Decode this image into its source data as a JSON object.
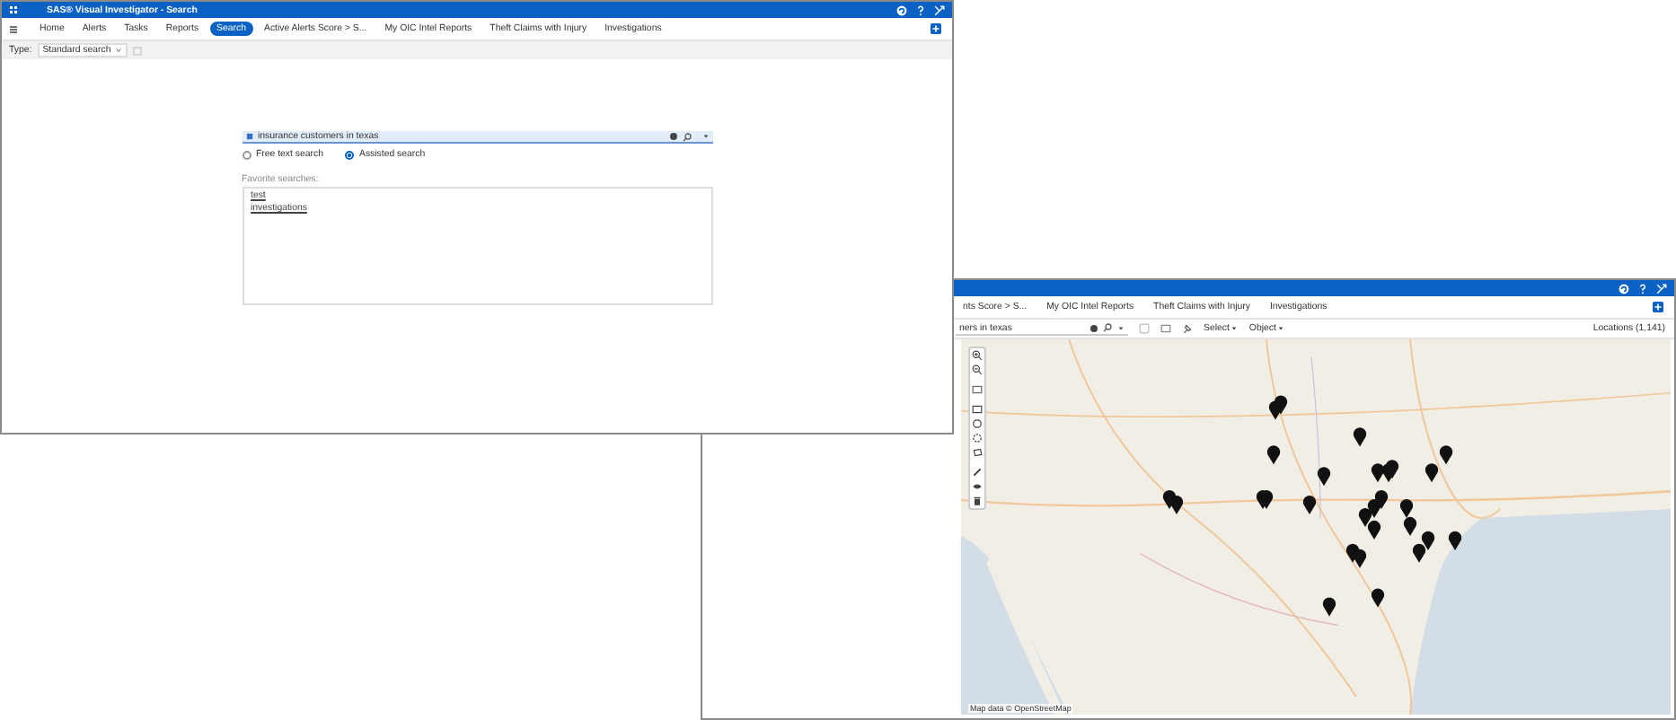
{
  "search_window": {
    "title": "SAS® Visual Investigator - Search",
    "tabs": [
      {
        "label": "Home",
        "selected": false
      },
      {
        "label": "Alerts",
        "selected": false
      },
      {
        "label": "Tasks",
        "selected": false
      },
      {
        "label": "Reports",
        "selected": false
      },
      {
        "label": "Search",
        "selected": true
      },
      {
        "label": "Active Alerts Score > S...",
        "selected": false
      },
      {
        "label": "My OIC Intel Reports",
        "selected": false
      },
      {
        "label": "Theft Claims with Injury",
        "selected": false
      },
      {
        "label": "Investigations",
        "selected": false
      }
    ],
    "type_label": "Type:",
    "type_value": "Standard search",
    "query": "insurance customers in texas",
    "modes": [
      {
        "label": "Free text search",
        "selected": false
      },
      {
        "label": "Assisted search",
        "selected": true
      }
    ],
    "favorites_label": "Favorite searches:",
    "favorites": [
      "test",
      "investigations"
    ]
  },
  "map_window": {
    "tabs": [
      {
        "label": "nts Score > S...",
        "selected": false
      },
      {
        "label": "My OIC Intel Reports",
        "selected": false
      },
      {
        "label": "Theft Claims with Injury",
        "selected": false
      },
      {
        "label": "Investigations",
        "selected": false
      }
    ],
    "query": "ners in texas",
    "menus": [
      "Select",
      "Object"
    ],
    "locations": "Locations (1,141)",
    "attribution": "Map data © OpenStreetMap"
  }
}
